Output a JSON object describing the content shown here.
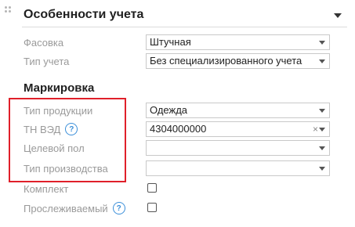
{
  "header": {
    "title": "Особенности учета"
  },
  "fields": {
    "packing": {
      "label": "Фасовка",
      "value": "Штучная"
    },
    "accounting_type": {
      "label": "Тип учета",
      "value": "Без специализированного учета"
    }
  },
  "marking": {
    "heading": "Маркировка",
    "product_type": {
      "label": "Тип продукции",
      "value": "Одежда"
    },
    "tn_ved": {
      "label": "ТН ВЭД",
      "value": "4304000000",
      "help": "?",
      "clear": "×"
    },
    "target_gender": {
      "label": "Целевой пол",
      "value": ""
    },
    "production_type": {
      "label": "Тип производства",
      "value": ""
    }
  },
  "checkboxes": {
    "kit": {
      "label": "Комплект",
      "checked": false
    },
    "traceable": {
      "label": "Прослеживаемый",
      "help": "?",
      "checked": false
    }
  },
  "colors": {
    "highlight": "#e0202a",
    "help_icon": "#3b8fd9"
  }
}
